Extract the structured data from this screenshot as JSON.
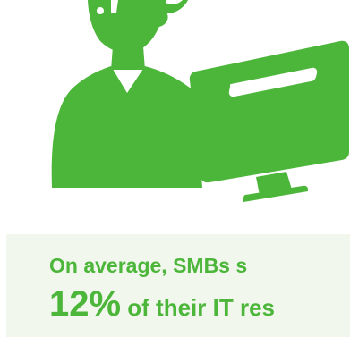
{
  "colors": {
    "accent": "#4cb63a",
    "panel_background": "#f1f7ec"
  },
  "hero": {
    "icon": "support-agent-with-monitor-icon"
  },
  "stat": {
    "line1": "On average, SMBs s",
    "figure": "12%",
    "line2_rest": " of their IT res"
  }
}
